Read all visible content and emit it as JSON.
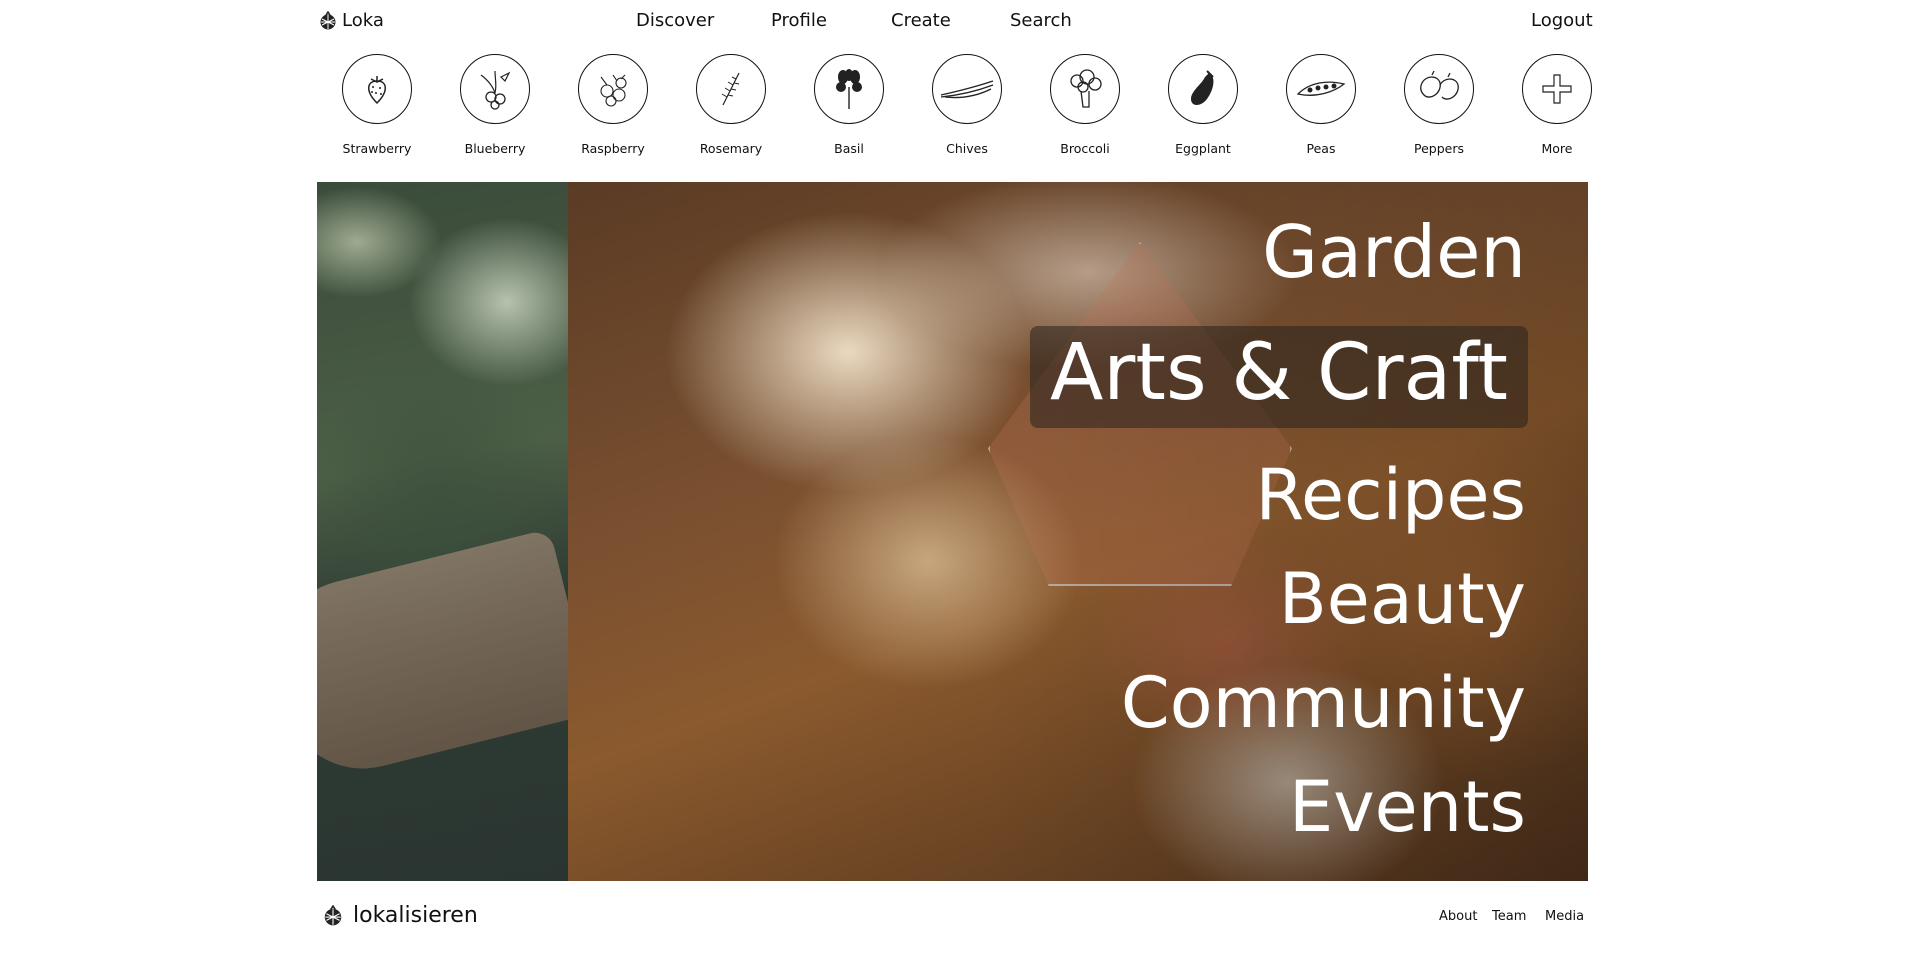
{
  "header": {
    "brand_name": "Loka",
    "brand_icon": "raspberry-logo-icon",
    "nav": [
      "Discover",
      "Profile",
      "Create",
      "Search"
    ],
    "logout_label": "Logout"
  },
  "categories": [
    {
      "label": "Strawberry",
      "icon": "strawberry-icon"
    },
    {
      "label": "Blueberry",
      "icon": "blueberry-icon"
    },
    {
      "label": "Raspberry",
      "icon": "raspberry-icon"
    },
    {
      "label": "Rosemary",
      "icon": "rosemary-icon"
    },
    {
      "label": "Basil",
      "icon": "basil-icon"
    },
    {
      "label": "Chives",
      "icon": "chives-icon"
    },
    {
      "label": "Broccoli",
      "icon": "broccoli-icon"
    },
    {
      "label": "Eggplant",
      "icon": "eggplant-icon"
    },
    {
      "label": "Peas",
      "icon": "peas-icon"
    },
    {
      "label": "Peppers",
      "icon": "peppers-icon"
    },
    {
      "label": "More",
      "icon": "plus-icon"
    }
  ],
  "hero": {
    "menu": [
      "Garden",
      "Arts & Craft",
      "Recipes",
      "Beauty",
      "Community",
      "Events"
    ],
    "active": "Arts & Craft"
  },
  "footer": {
    "brand_name": "lokalisieren",
    "links": [
      "About",
      "Team",
      "Media"
    ]
  }
}
